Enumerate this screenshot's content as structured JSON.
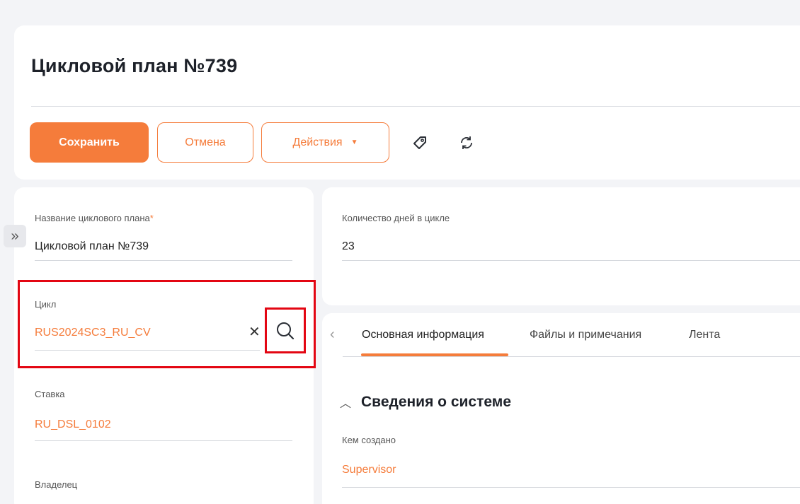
{
  "header": {
    "title": "Цикловой план №739",
    "save_label": "Сохранить",
    "cancel_label": "Отмена",
    "actions_label": "Действия"
  },
  "icons": {
    "tag": "tag-icon",
    "refresh": "refresh-icon",
    "expand": "double-chevron-right-icon",
    "search": "search-icon",
    "clear": "close-icon"
  },
  "left_panel": {
    "plan_name": {
      "label": "Название циклового плана",
      "required_mark": "*",
      "value": "Цикловой план №739"
    },
    "cycle": {
      "label": "Цикл",
      "value": "RUS2024SC3_RU_CV"
    },
    "rate": {
      "label": "Ставка",
      "value": "RU_DSL_0102"
    },
    "owner": {
      "label": "Владелец"
    }
  },
  "right_panel": {
    "days_in_cycle": {
      "label": "Количество дней в цикле",
      "value": "23"
    },
    "tabs": [
      {
        "label": "Основная информация",
        "active": true
      },
      {
        "label": "Файлы и примечания",
        "active": false
      },
      {
        "label": "Лента",
        "active": false
      }
    ],
    "section": {
      "title": "Сведения о системе",
      "created_by": {
        "label": "Кем создано",
        "value": "Supervisor"
      }
    }
  },
  "colors": {
    "accent": "#f57c3b",
    "highlight": "#e30613",
    "background": "#f3f4f7"
  }
}
